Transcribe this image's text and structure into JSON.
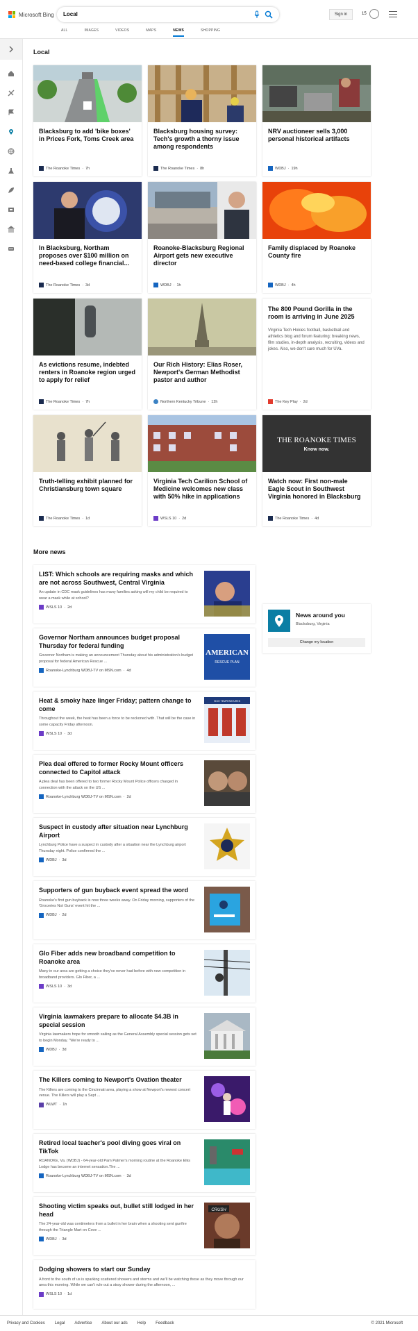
{
  "header": {
    "brand": "Microsoft Bing",
    "query": "Local",
    "signin": "Sign in",
    "rewards": "15",
    "tabs": [
      "ALL",
      "IMAGES",
      "VIDEOS",
      "MAPS",
      "NEWS",
      "SHOPPING"
    ],
    "active_tab": "NEWS",
    "colors": {
      "accent": "#0078d4"
    }
  },
  "sidebar": {
    "icons": [
      "expand-icon",
      "home-icon",
      "sports-icon",
      "flag-icon",
      "location-pin-icon",
      "globe-icon",
      "science-icon",
      "rocket-icon",
      "entertainment-icon",
      "money-icon",
      "car-icon"
    ]
  },
  "local": {
    "title": "Local",
    "cards": [
      {
        "title": "Blacksburg to add 'bike boxes' in Prices Fork, Toms Creek area",
        "source": "The Roanoke Times",
        "time": "7h",
        "icon": "image-street"
      },
      {
        "title": "Blacksburg housing survey: Tech's growth a thorny issue among respondents",
        "source": "The Roanoke Times",
        "time": "8h",
        "icon": "image-construction"
      },
      {
        "title": "NRV auctioneer sells 3,000 personal historical artifacts",
        "source": "WDBJ",
        "time": "19h",
        "icon": "image-auction"
      },
      {
        "title": "In Blacksburg, Northam proposes over $100 million on need-based college financial...",
        "source": "The Roanoke Times",
        "time": "3d",
        "icon": "image-governor"
      },
      {
        "title": "Roanoke-Blacksburg Regional Airport gets new executive director",
        "source": "WDBJ",
        "time": "1h",
        "icon": "image-airport"
      },
      {
        "title": "Family displaced by Roanoke County fire",
        "source": "WDBJ",
        "time": "4h",
        "icon": "image-fire"
      },
      {
        "title": "As evictions resume, indebted renters in Roanoke region urged to apply for relief",
        "source": "The Roanoke Times",
        "time": "7h",
        "icon": "image-door"
      },
      {
        "title": "Our Rich History: Elias Roser, Newport's German Methodist pastor and author",
        "source": "Northern Kentucky Tribune",
        "time": "12h",
        "icon": "image-steeple"
      },
      {
        "title": "The 800 Pound Gorilla in the room is arriving in June 2025",
        "snippet": "Virginia Tech Hokies football, basketball and athletics blog and forum featuring: breaking news, film studies, in-depth analysis, recruiting, videos and jokes. Also, we don't care much for UVa.",
        "source": "The Key Play",
        "time": "2d",
        "icon": "none"
      },
      {
        "title": "Truth-telling exhibit planned for Christiansburg town square",
        "source": "The Roanoke Times",
        "time": "1d",
        "icon": "image-drawing"
      },
      {
        "title": "Virginia Tech Carilion School of Medicine welcomes new class with 50% hike in applications",
        "source": "WSLS 10",
        "time": "2d",
        "icon": "image-building"
      },
      {
        "title": "Watch now: First non-male Eagle Scout in Southwest Virginia honored in Blacksburg",
        "source": "The Roanoke Times",
        "time": "4d",
        "icon": "image-logo"
      }
    ],
    "logo_banner": {
      "name": "THE ROANOKE TIMES",
      "tag": "Know now."
    }
  },
  "more_news": {
    "title": "More news",
    "items": [
      {
        "title": "LIST: Which schools are requiring masks and which are not across Southwest, Central Virginia",
        "snippet": "An update in CDC mask guidelines has many families asking will my child be required to wear a mask while at school?",
        "source": "WSLS 10",
        "time": "2d"
      },
      {
        "title": "Governor Northam announces budget proposal Thursday for federal funding",
        "snippet": "Governor Northam is making an announcement Thursday about his administration's budget proposal for federal American Rescue ...",
        "source": "Roanoke-Lynchburg WDBJ-TV on MSN.com",
        "time": "4d"
      },
      {
        "title": "Heat & smoky haze linger Friday; pattern change to come",
        "snippet": "Throughout the week, the heat has been a force to be reckoned with. That will be the case in some capacity Friday afternoon.",
        "source": "WSLS 10",
        "time": "3d"
      },
      {
        "title": "Plea deal offered to former Rocky Mount officers connected to Capitol attack",
        "snippet": "A plea deal has been offered to two former Rocky Mount Police officers charged in connection with the attack on the US ...",
        "source": "Roanoke-Lynchburg WDBJ-TV on MSN.com",
        "time": "2d"
      },
      {
        "title": "Suspect in custody after situation near Lynchburg Airport",
        "snippet": "Lynchburg Police have a suspect in custody after a situation near the Lynchburg airport Thursday night. Police confirmed the ...",
        "source": "WDBJ",
        "time": "3d"
      },
      {
        "title": "Supporters of gun buyback event spread the word",
        "snippet": "Roanoke's first gun buyback is now three weeks away. On Friday morning, supporters of the 'Groceries Not Guns' event hit the ...",
        "source": "WDBJ",
        "time": "2d"
      },
      {
        "title": "Glo Fiber adds new broadband competition to Roanoke area",
        "snippet": "Many in our area are getting a choice they've never had before with new competition in broadband providers. Glo Fiber, a ...",
        "source": "WSLS 10",
        "time": "3d"
      },
      {
        "title": "Virginia lawmakers prepare to allocate $4.3B in special session",
        "snippet": "Virginia lawmakers hope for smooth sailing as the General Assembly special session gets set to begin Monday. \"We're ready to ...",
        "source": "WDBJ",
        "time": "3d"
      },
      {
        "title": "The Killers coming to Newport's Ovation theater",
        "snippet": "The Killers are coming to the Cincinnati area, playing a show at Newport's newest concert venue. The Killers will play a Sept ...",
        "source": "WLWT",
        "time": "1h"
      },
      {
        "title": "Retired local teacher's pool diving goes viral on TikTok",
        "snippet": "ROANOKE, Va. (WDBJ) - 64-year-old Pam Palmer's morning routine at the Roanoke Elks Lodge has become an internet sensation.The ...",
        "source": "Roanoke-Lynchburg WDBJ-TV on MSN.com",
        "time": "3d"
      },
      {
        "title": "Shooting victim speaks out, bullet still lodged in her head",
        "snippet": "The 24-year-old was centimeters from a bullet in her brain when a shooting sent gunfire through the Triangle Mart on Cove ...",
        "source": "WDBJ",
        "time": "3d"
      },
      {
        "title": "Dodging showers to start our Sunday",
        "snippet": "A front to the south of us is sparking scattered showers and storms and we'll be watching those as they move through our area this morning. While we can't rule out a stray shower during the afternoon, ...",
        "source": "WSLS 10",
        "time": "1d"
      }
    ],
    "img_text": {
      "american": "AMERICAN",
      "rescue": "RESCUE PLAN",
      "heat": "HIGH TEMPERATURES",
      "crush": "CRUSH"
    }
  },
  "location_card": {
    "title": "News around you",
    "place": "Blacksburg, Virginia",
    "button": "Change my location"
  },
  "footer": {
    "links": [
      "Privacy and Cookies",
      "Legal",
      "Advertise",
      "About our ads",
      "Help",
      "Feedback"
    ],
    "copyright": "© 2021 Microsoft"
  }
}
